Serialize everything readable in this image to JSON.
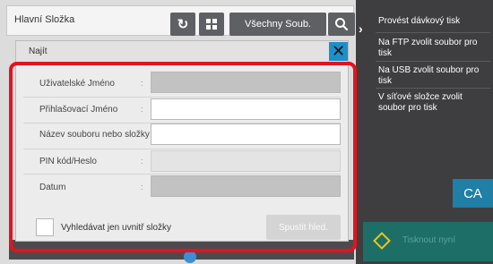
{
  "header": {
    "folder_title": "Hlavní Složka",
    "all_files_label": "Všechny Soub.",
    "refresh_glyph": "↻"
  },
  "right_panel": {
    "arrow_glyph": "›",
    "items": [
      {
        "label": "Provést dávkový tisk"
      },
      {
        "label": "Na FTP zvolit soubor pro tisk"
      },
      {
        "label": "Na USB zvolit soubor pro tisk"
      },
      {
        "label": "V síťové složce zvolit soubor pro tisk"
      }
    ],
    "ca_label": "CA",
    "start_label": "Tisknout nyní"
  },
  "dialog": {
    "title": "Najít",
    "close_glyph": "✕",
    "fields": [
      {
        "label": "Uživatelské Jméno",
        "value": ""
      },
      {
        "label": "Přihlašovací Jméno",
        "value": ""
      },
      {
        "label": "Název souboru nebo složky",
        "value": ""
      },
      {
        "label": "PIN kód/Heslo",
        "value": ""
      },
      {
        "label": "Datum",
        "value": ""
      }
    ],
    "colon": ":",
    "checkbox_label": "Vyhledávat jen uvnitř složky",
    "checkbox_checked": false,
    "submit_label": "Spustit hled."
  },
  "colors": {
    "highlight": "#e3131f",
    "close_button": "#1e8fc8",
    "ca_button": "#1f7fa6",
    "start_button": "#1e6e68"
  }
}
